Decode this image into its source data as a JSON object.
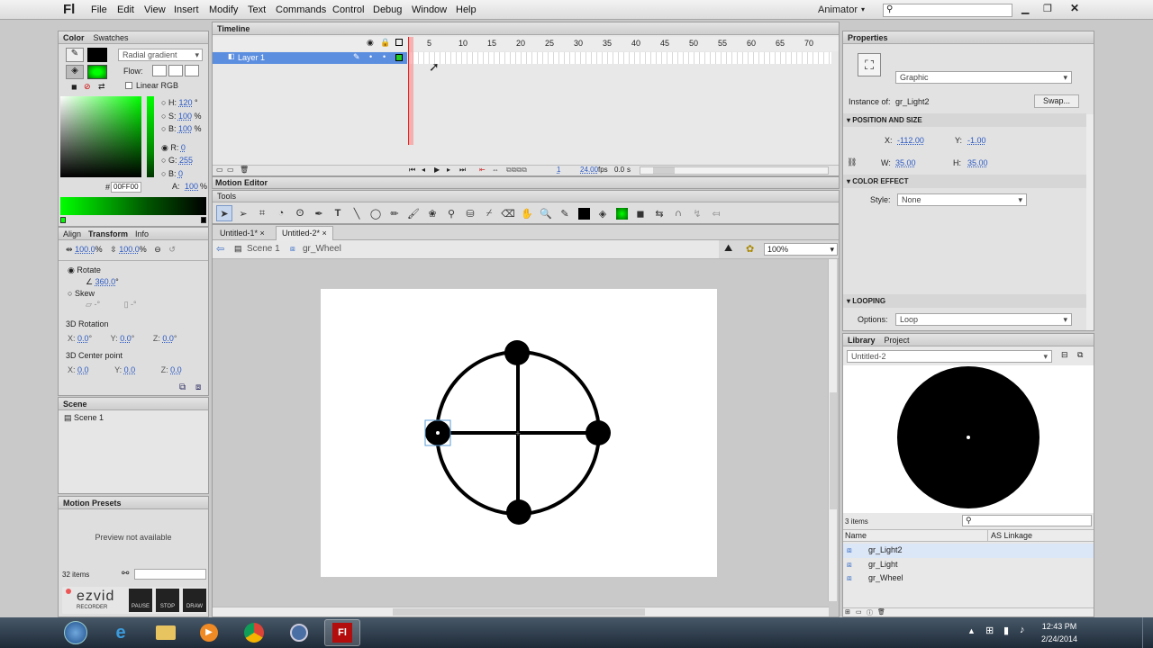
{
  "app": {
    "logo": "Fl",
    "workspace": "Animator",
    "search_placeholder": ""
  },
  "menu": [
    "File",
    "Edit",
    "View",
    "Insert",
    "Modify",
    "Text",
    "Commands",
    "Control",
    "Debug",
    "Window",
    "Help"
  ],
  "color_panel": {
    "tabs": [
      "Color",
      "Swatches"
    ],
    "type": "Radial gradient",
    "flow_label": "Flow:",
    "linear_rgb": "Linear RGB",
    "h_label": "H:",
    "h": "120",
    "h_unit": "°",
    "s_label": "S:",
    "s": "100",
    "s_unit": "%",
    "b_label": "B:",
    "b": "100",
    "b_unit": "%",
    "r_label": "R:",
    "r": "0",
    "g_label": "G:",
    "g": "255",
    "bl_label": "B:",
    "bl": "0",
    "hex_prefix": "#",
    "hex": "00FF00",
    "a_label": "A:",
    "alpha": "100",
    "a_unit": "%",
    "accent_color": "#00ff00"
  },
  "transform_panel": {
    "tabs": [
      "Align",
      "Transform",
      "Info"
    ],
    "scale_w": "100.0",
    "scale_h": "100.0",
    "pct": "%",
    "rotate": "Rotate",
    "rotate_val": "360.0",
    "deg": "°",
    "skew": "Skew",
    "skew_h": "-",
    "skew_v": "-",
    "rot3d": "3D Rotation",
    "x_label": "X:",
    "y_label": "Y:",
    "z_label": "Z:",
    "rx": "0.0",
    "ry": "0.0",
    "rz": "0.0",
    "center3d": "3D Center point",
    "cx": "0.0",
    "cy": "0.0",
    "cz": "0.0"
  },
  "scene_panel": {
    "title": "Scene",
    "item": "Scene 1"
  },
  "motion_presets": {
    "title": "Motion Presets",
    "preview": "Preview not available",
    "count": "32 items"
  },
  "ezvid": {
    "brand": "ezvid",
    "sub": "RECORDER",
    "pause": "PAUSE",
    "stop": "STOP",
    "draw": "DRAW"
  },
  "timeline": {
    "tab": "Timeline",
    "ruler": [
      "5",
      "10",
      "15",
      "20",
      "25",
      "30",
      "35",
      "40",
      "45",
      "50",
      "55",
      "60",
      "65",
      "70"
    ],
    "layer": "Layer 1",
    "frame": "1",
    "fps": "24.00",
    "fps_unit": "fps",
    "time": "0.0",
    "time_unit": "s"
  },
  "motion_editor": "Motion Editor",
  "tools_label": "Tools",
  "docs": {
    "tab1": "Untitled-1*",
    "tab2": "Untitled-2*"
  },
  "breadcrumb": {
    "scene": "Scene 1",
    "symbol": "gr_Wheel"
  },
  "zoom": "100%",
  "properties": {
    "title": "Properties",
    "type": "Graphic",
    "instance_label": "Instance of:",
    "instance": "gr_Light2",
    "swap": "Swap...",
    "pos_size": "POSITION AND SIZE",
    "x_label": "X:",
    "x": "-112.00",
    "y_label": "Y:",
    "y": "-1.00",
    "w_label": "W:",
    "w": "35.00",
    "h_label": "H:",
    "h": "35.00",
    "color_effect": "COLOR EFFECT",
    "style_label": "Style:",
    "style": "None",
    "looping": "LOOPING",
    "options_label": "Options:",
    "options": "Loop"
  },
  "library": {
    "tabs": [
      "Library",
      "Project"
    ],
    "doc": "Untitled-2",
    "count": "3 items",
    "col_name": "Name",
    "col_link": "AS Linkage",
    "items": [
      "gr_Light2",
      "gr_Light",
      "gr_Wheel"
    ]
  },
  "clock": {
    "time": "12:43 PM",
    "date": "2/24/2014"
  }
}
